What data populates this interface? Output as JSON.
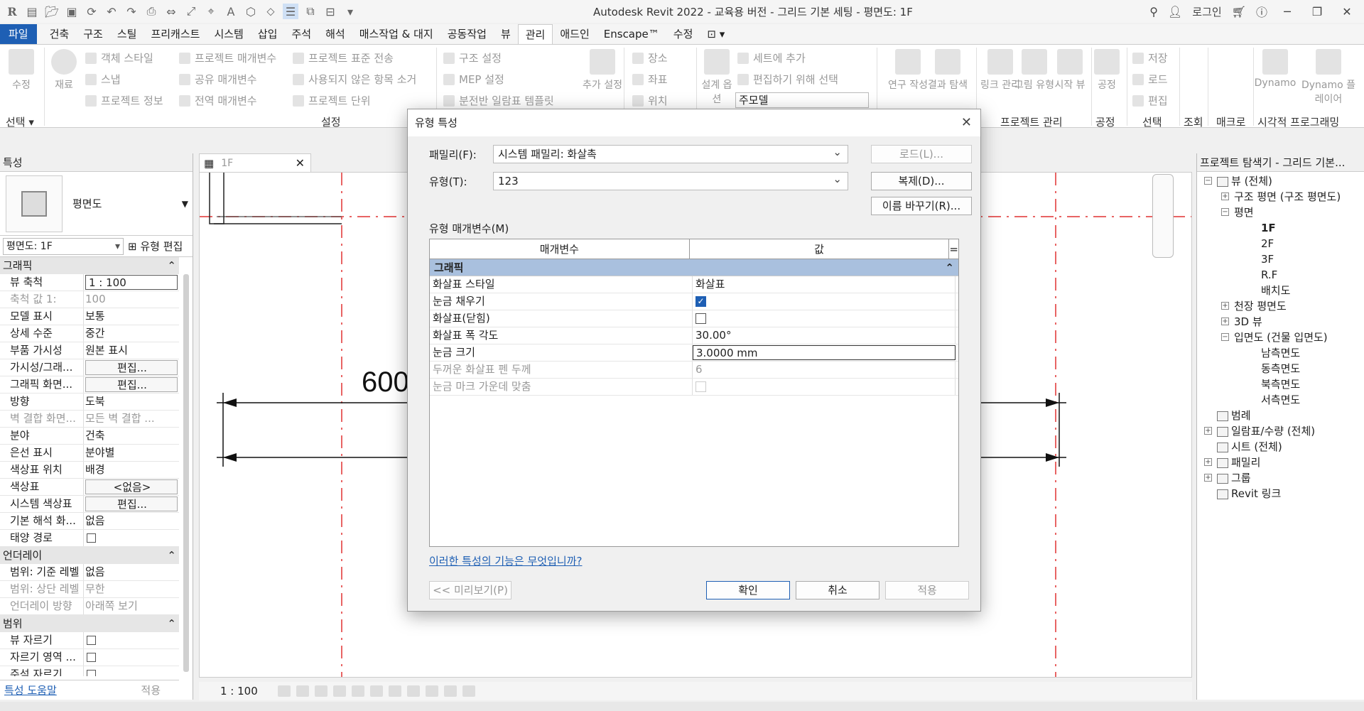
{
  "app": {
    "title": "Autodesk Revit 2022 - 교육용 버전 - 그리드 기본 세팅 - 평면도: 1F",
    "login": "로그인"
  },
  "tabs": [
    "파일",
    "건축",
    "구조",
    "스틸",
    "프리캐스트",
    "시스템",
    "삽입",
    "주석",
    "해석",
    "매스작업 & 대지",
    "공동작업",
    "뷰",
    "관리",
    "애드인",
    "Enscape™",
    "수정"
  ],
  "active_tab": "관리",
  "ribbon": {
    "modify": "수정",
    "material": "재료",
    "object_style": "객체 스타일",
    "snap": "스냅",
    "project_info": "프로젝트 정보",
    "project_params": "프로젝트 매개변수",
    "shared_params": "공유 매개변수",
    "global_params": "전역 매개변수",
    "transfer_standards": "프로젝트 표준 전송",
    "purge": "사용되지 않은 항목 소거",
    "project_units": "프로젝트 단위",
    "structural_settings": "구조 설정",
    "mep_settings": "MEP 설정",
    "panel_schedule": "분전반 일람표 템플릿",
    "additional_settings": "추가 설정",
    "location": "장소",
    "coordinates": "좌표",
    "position": "위치",
    "design_options": "설계 옵션",
    "add_to_set": "세트에 추가",
    "pick_to_edit": "편집하기 위해 선택",
    "main_model": "주모델",
    "manage_links": "링크 관리",
    "manage_images": "그림 유형",
    "starting_view": "시작 뷰",
    "phases": "공정",
    "save": "저장",
    "load": "로드",
    "edit": "편집",
    "inquiry": "조회",
    "macro": "매크로",
    "dynamo": "Dynamo",
    "dynamo_player": "Dynamo 플레이어",
    "study_create": "연구 작성",
    "result_explore": "결과 탐색",
    "groups": {
      "select": "선택",
      "settings": "설정",
      "project_mgmt": "프로젝트 관리",
      "phasing": "공정",
      "selection": "선택",
      "inquiry": "조회",
      "macros": "매크로",
      "visual_programming": "시각적 프로그래밍"
    }
  },
  "properties": {
    "header": "특성",
    "type_name": "평면도",
    "filter": "평면도: 1F",
    "edit_type": "유형 편집",
    "sections": [
      {
        "title": "그래픽",
        "rows": [
          {
            "k": "뷰 축척",
            "v": "1 : 100",
            "style": "boxed"
          },
          {
            "k": "축척 값   1:",
            "v": "100",
            "dim": true
          },
          {
            "k": "모델 표시",
            "v": "보통"
          },
          {
            "k": "상세 수준",
            "v": "중간"
          },
          {
            "k": "부품 가시성",
            "v": "원본 표시"
          },
          {
            "k": "가시성/그래...",
            "v": "편집...",
            "style": "btn"
          },
          {
            "k": "그래픽 화면...",
            "v": "편집...",
            "style": "btn"
          },
          {
            "k": "방향",
            "v": "도북"
          },
          {
            "k": "벽 결합 화면...",
            "v": "모든 벽 결합 ...",
            "dim": true
          },
          {
            "k": "분야",
            "v": "건축"
          },
          {
            "k": "은선 표시",
            "v": "분야별"
          },
          {
            "k": "색상표 위치",
            "v": "배경"
          },
          {
            "k": "색상표",
            "v": "<없음>",
            "style": "btn"
          },
          {
            "k": "시스템 색상표",
            "v": "편집...",
            "style": "btn"
          },
          {
            "k": "기본 해석 화...",
            "v": "없음"
          },
          {
            "k": "태양 경로",
            "v": "",
            "style": "check"
          }
        ]
      },
      {
        "title": "언더레이",
        "rows": [
          {
            "k": "범위: 기준 레벨",
            "v": "없음"
          },
          {
            "k": "범위: 상단 레벨",
            "v": "무한",
            "dim": true
          },
          {
            "k": "언더레이 방향",
            "v": "아래쪽 보기",
            "dim": true
          }
        ]
      },
      {
        "title": "범위",
        "rows": [
          {
            "k": "뷰 자르기",
            "v": "",
            "style": "check"
          },
          {
            "k": "자르기 영역 ...",
            "v": "",
            "style": "check"
          },
          {
            "k": "주석 자르기",
            "v": "",
            "style": "check"
          }
        ]
      }
    ],
    "help": "특성 도움말",
    "apply": "적용"
  },
  "view": {
    "tab_label": "1F",
    "dimension_text": "600",
    "scale": "1 : 100"
  },
  "browser": {
    "header": "프로젝트 탐색기 - 그리드 기본...",
    "items": [
      {
        "label": "뷰 (전체)",
        "level": 0,
        "exp": "−",
        "icon": true
      },
      {
        "label": "구조 평면 (구조 평면도)",
        "level": 1,
        "exp": "+"
      },
      {
        "label": "평면",
        "level": 1,
        "exp": "−"
      },
      {
        "label": "1F",
        "level": 2,
        "bold": true
      },
      {
        "label": "2F",
        "level": 2
      },
      {
        "label": "3F",
        "level": 2
      },
      {
        "label": "R.F",
        "level": 2
      },
      {
        "label": "배치도",
        "level": 2
      },
      {
        "label": "천장 평면도",
        "level": 1,
        "exp": "+"
      },
      {
        "label": "3D 뷰",
        "level": 1,
        "exp": "+"
      },
      {
        "label": "입면도 (건물 입면도)",
        "level": 1,
        "exp": "−"
      },
      {
        "label": "남측면도",
        "level": 2
      },
      {
        "label": "동측면도",
        "level": 2
      },
      {
        "label": "북측면도",
        "level": 2
      },
      {
        "label": "서측면도",
        "level": 2
      },
      {
        "label": "범례",
        "level": 0,
        "icon": true
      },
      {
        "label": "일람표/수량 (전체)",
        "level": 0,
        "exp": "+",
        "icon": true
      },
      {
        "label": "시트 (전체)",
        "level": 0,
        "icon": true
      },
      {
        "label": "패밀리",
        "level": 0,
        "exp": "+",
        "icon": true
      },
      {
        "label": "그룹",
        "level": 0,
        "exp": "+",
        "icon": true
      },
      {
        "label": "Revit 링크",
        "level": 0,
        "icon": true
      }
    ]
  },
  "dialog": {
    "title": "유형 특성",
    "family_label": "패밀리(F):",
    "family_value": "시스템 패밀리: 화살촉",
    "type_label": "유형(T):",
    "type_value": "123",
    "load_btn": "로드(L)...",
    "duplicate_btn": "복제(D)...",
    "rename_btn": "이름 바꾸기(R)...",
    "params_label": "유형 매개변수(M)",
    "col_param": "매개변수",
    "col_value": "값",
    "col_eq": "=",
    "section": "그래픽",
    "rows": [
      {
        "k": "화살표 스타일",
        "v": "화살표"
      },
      {
        "k": "눈금 채우기",
        "v": "",
        "check": "on"
      },
      {
        "k": "화살표(닫힘)",
        "v": "",
        "check": "off"
      },
      {
        "k": "화살표 폭 각도",
        "v": "30.00°"
      },
      {
        "k": "눈금 크기",
        "v": "3.0000 mm",
        "boxed": true
      },
      {
        "k": "두꺼운 화살표 펜 두께",
        "v": "6",
        "dim": true
      },
      {
        "k": "눈금 마크 가운데 맞춤",
        "v": "",
        "check": "dis",
        "dim": true
      }
    ],
    "help_link": "이러한 특성의 기능은 무엇입니까?",
    "preview_btn": "<< 미리보기(P)",
    "ok_btn": "확인",
    "cancel_btn": "취소",
    "apply_btn": "적용"
  },
  "colors": {
    "accent": "#1e5fb4",
    "section_blue": "#a9c0de",
    "grid_red": "#e03030"
  }
}
